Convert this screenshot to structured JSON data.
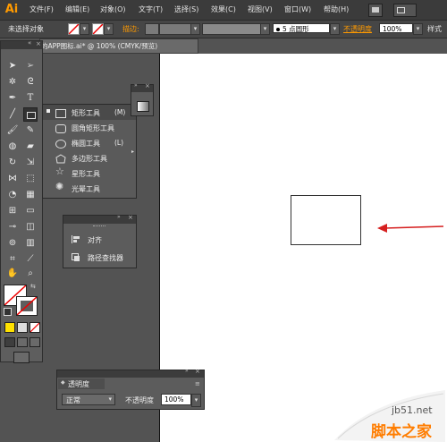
{
  "app": {
    "logo_text": "Ai"
  },
  "menu": {
    "items": [
      "文件(F)",
      "编辑(E)",
      "对象(O)",
      "文字(T)",
      "选择(S)",
      "效果(C)",
      "视图(V)",
      "窗口(W)",
      "帮助(H)"
    ]
  },
  "control_bar": {
    "selection_status": "未选择对象",
    "stroke_label": "描边:",
    "brush_label": "5 点圆形",
    "opacity_label": "不透明度",
    "opacity_value": "100%",
    "style_label": "样式"
  },
  "document_tab": {
    "title": "的APP图标.ai* @ 100% (CMYK/预览)"
  },
  "flyout": {
    "items": [
      {
        "label": "矩形工具",
        "shortcut": "(M)",
        "icon": "rectangle-icon",
        "active": true
      },
      {
        "label": "圆角矩形工具",
        "shortcut": "",
        "icon": "rounded-rectangle-icon",
        "active": false
      },
      {
        "label": "椭圆工具",
        "shortcut": "(L)",
        "icon": "ellipse-icon",
        "active": false
      },
      {
        "label": "多边形工具",
        "shortcut": "",
        "icon": "polygon-icon",
        "active": false
      },
      {
        "label": "星形工具",
        "shortcut": "",
        "icon": "star-icon",
        "active": false
      },
      {
        "label": "光晕工具",
        "shortcut": "",
        "icon": "flare-icon",
        "active": false
      }
    ]
  },
  "align_panel": {
    "items": [
      {
        "label": "对齐",
        "icon": "align-icon"
      },
      {
        "label": "路径查找器",
        "icon": "pathfinder-icon"
      }
    ]
  },
  "transparency_panel": {
    "title": "透明度",
    "blend_mode": "正常",
    "opacity_label": "不透明度",
    "opacity_value": "100%"
  },
  "watermark": {
    "line1": "jb51.net",
    "line2": "脚本之家"
  },
  "colors": {
    "accent_orange": "#ff9a00",
    "arrow_red": "#d62020",
    "watermark_orange": "#ff7d00"
  }
}
